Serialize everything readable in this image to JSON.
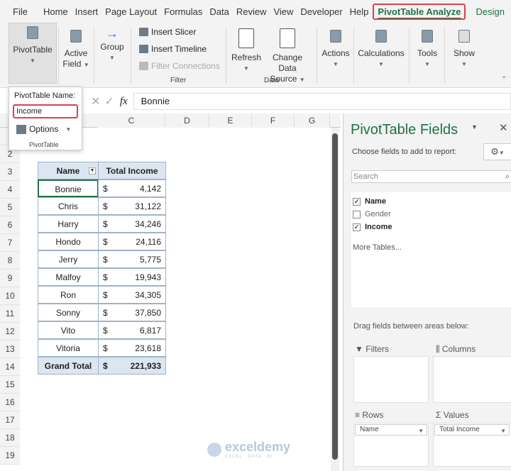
{
  "tabs": [
    "File",
    "Home",
    "Insert",
    "Page Layout",
    "Formulas",
    "Data",
    "Review",
    "View",
    "Developer",
    "Help",
    "PivotTable Analyze",
    "Design"
  ],
  "ribbon": {
    "pivottable": "PivotTable",
    "active_field": "Active",
    "active_field2": "Field",
    "group": "Group",
    "insert_slicer": "Insert Slicer",
    "insert_timeline": "Insert Timeline",
    "filter_connections": "Filter Connections",
    "filter_group": "Filter",
    "refresh": "Refresh",
    "change_data": "Change Data",
    "change_data2": "Source",
    "data_group": "Data",
    "actions": "Actions",
    "calculations": "Calculations",
    "tools": "Tools",
    "show": "Show"
  },
  "popup": {
    "label": "PivotTable Name:",
    "value": "Income",
    "options": "Options",
    "group": "PivotTable"
  },
  "formula": {
    "fx": "fx",
    "value": "Bonnie"
  },
  "columns": [
    "C",
    "D",
    "E",
    "F",
    "G"
  ],
  "row_numbers": [
    "2",
    "3",
    "4",
    "5",
    "6",
    "7",
    "8",
    "9",
    "10",
    "11",
    "12",
    "13",
    "14",
    "15",
    "16",
    "17",
    "18",
    "19"
  ],
  "pivot": {
    "header_name": "Name",
    "header_value": "Total Income",
    "currency": "$",
    "rows": [
      {
        "name": "Bonnie",
        "value": "4,142"
      },
      {
        "name": "Chris",
        "value": "31,122"
      },
      {
        "name": "Harry",
        "value": "34,246"
      },
      {
        "name": "Hondo",
        "value": "24,116"
      },
      {
        "name": "Jerry",
        "value": "5,775"
      },
      {
        "name": "Malfoy",
        "value": "19,943"
      },
      {
        "name": "Ron",
        "value": "34,305"
      },
      {
        "name": "Sonny",
        "value": "37,850"
      },
      {
        "name": "Vito",
        "value": "6,817"
      },
      {
        "name": "Vitoria",
        "value": "23,618"
      }
    ],
    "total_label": "Grand Total",
    "total_value": "221,933"
  },
  "panel": {
    "title": "PivotTable Fields",
    "choose": "Choose fields to add to report:",
    "search_placeholder": "Search",
    "fields": [
      {
        "label": "Name",
        "checked": true
      },
      {
        "label": "Gender",
        "checked": false
      },
      {
        "label": "Income",
        "checked": true
      }
    ],
    "more_tables": "More Tables...",
    "drag": "Drag fields between areas below:",
    "filters": "Filters",
    "columns": "Columns",
    "rows": "Rows",
    "values": "Values",
    "rows_item": "Name",
    "values_item": "Total Income"
  },
  "watermark": "exceldemy",
  "watermark_sub": "EXCEL · DATA · BI"
}
